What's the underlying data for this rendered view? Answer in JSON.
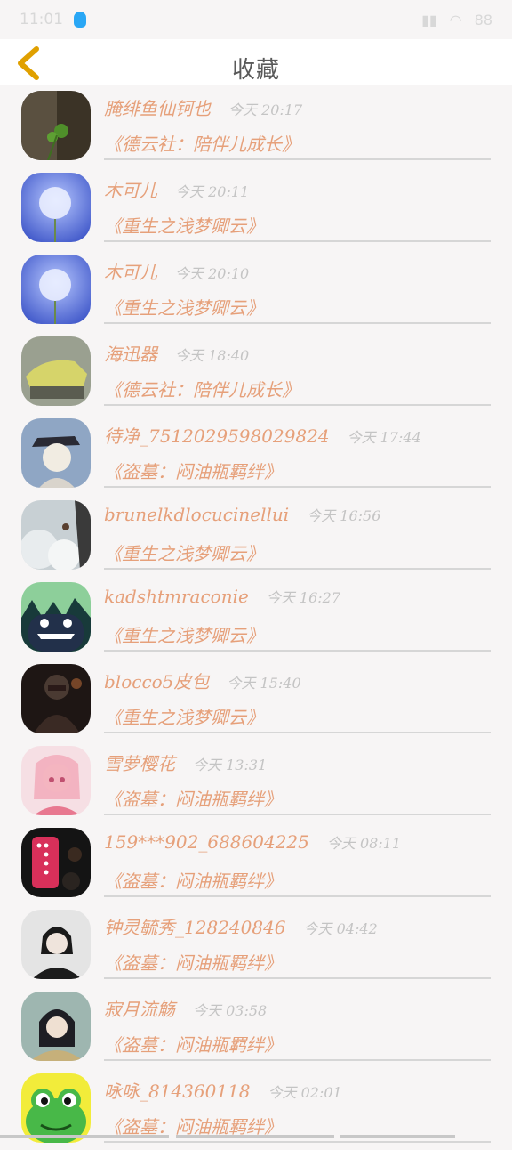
{
  "status": {
    "time": "11:01",
    "battery": "88"
  },
  "header": {
    "title": "收藏"
  },
  "items": [
    {
      "user": "腌绯鱼仙钶也",
      "time": "今天 20:17",
      "book": "《德云社：陪伴儿成长》"
    },
    {
      "user": "木可儿",
      "time": "今天 20:11",
      "book": "《重生之浅梦卿云》"
    },
    {
      "user": "木可儿",
      "time": "今天 20:10",
      "book": "《重生之浅梦卿云》"
    },
    {
      "user": "海迅器",
      "time": "今天 18:40",
      "book": "《德云社：陪伴儿成长》"
    },
    {
      "user": "待净_7512029598029824",
      "time": "今天 17:44",
      "book": "《盗墓：闷油瓶羁绊》"
    },
    {
      "user": "brunelkdlocucinellui",
      "time": "今天 16:56",
      "book": "《重生之浅梦卿云》"
    },
    {
      "user": "kadshtmraconie",
      "time": "今天 16:27",
      "book": "《重生之浅梦卿云》"
    },
    {
      "user": "blocco5皮包",
      "time": "今天 15:40",
      "book": "《重生之浅梦卿云》"
    },
    {
      "user": "雪萝樱花",
      "time": "今天 13:31",
      "book": "《盗墓：闷油瓶羁绊》"
    },
    {
      "user": "159***902_688604225",
      "time": "今天 08:11",
      "book": "《盗墓：闷油瓶羁绊》"
    },
    {
      "user": "钟灵毓秀_128240846",
      "time": "今天 04:42",
      "book": "《盗墓：闷油瓶羁绊》"
    },
    {
      "user": "寂月流觞",
      "time": "今天 03:58",
      "book": "《盗墓：闷油瓶羁绊》"
    },
    {
      "user": "咏咏_814360118",
      "time": "今天 02:01",
      "book": "《盗墓：闷油瓶羁绊》"
    }
  ],
  "colors": {
    "accent": "#e6a07a",
    "time": "#c4c4c4",
    "separator": "#d6d6d6"
  },
  "icons": {
    "back": "chevron-left-icon"
  }
}
